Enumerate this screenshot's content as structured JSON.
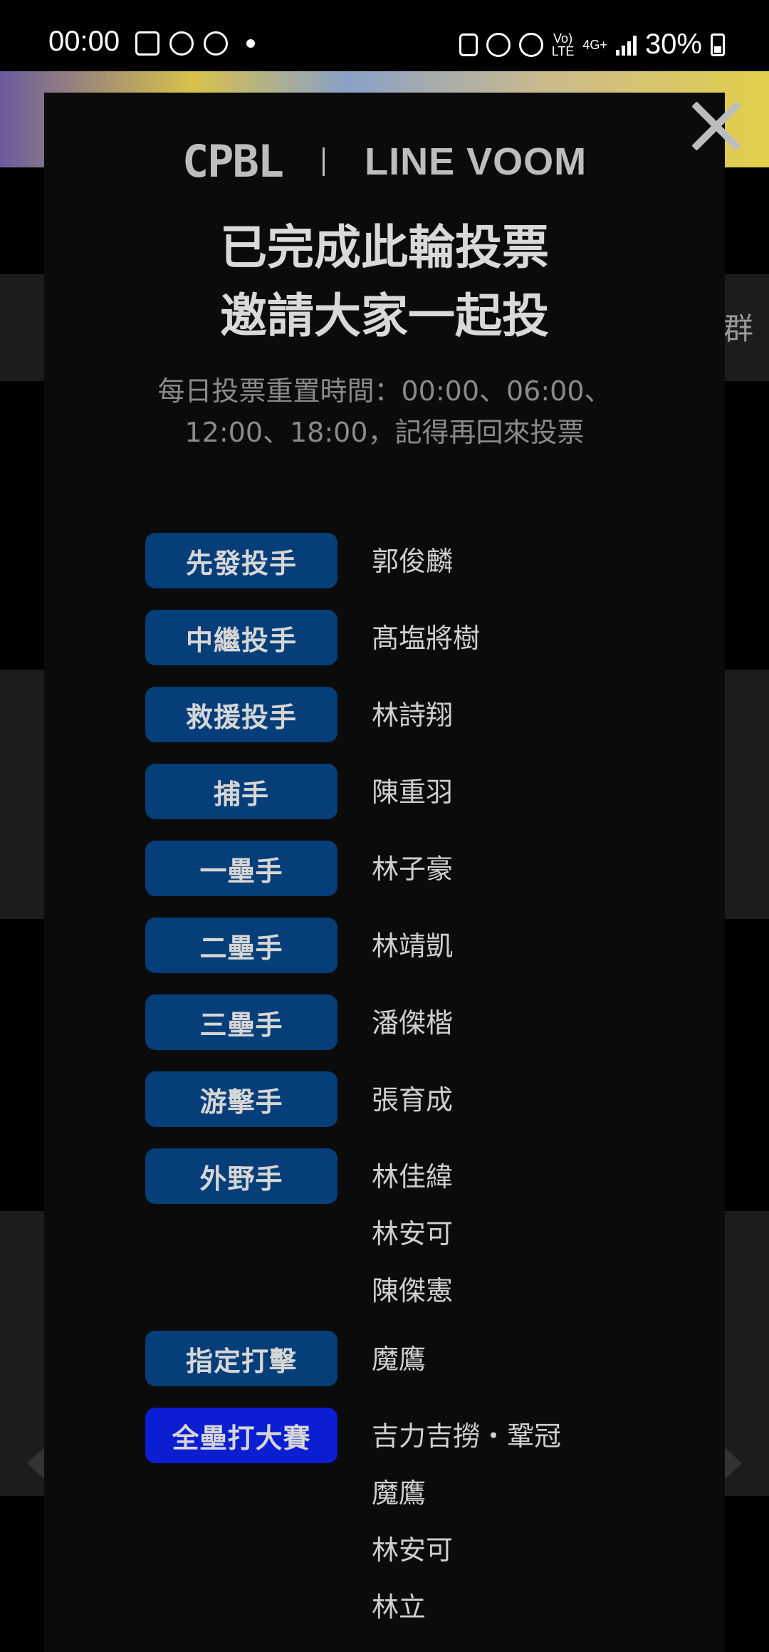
{
  "status_bar": {
    "time": "00:00",
    "network_volte": "Vo)\nLTE",
    "network_4g": "4G+",
    "battery_percent": "30%"
  },
  "background": {
    "edge_text": "群"
  },
  "modal": {
    "logo_left": "CPBL",
    "logo_right": "LINE VOOM",
    "headline_line1": "已完成此輪投票",
    "headline_line2": "邀請大家一起投",
    "reset_note": "每日投票重置時間：00:00、06:00、12:00、18:00，記得再回來投票",
    "votes": [
      {
        "position": "先發投手",
        "names": [
          "郭俊麟"
        ]
      },
      {
        "position": "中繼投手",
        "names": [
          "髙塩將樹"
        ]
      },
      {
        "position": "救援投手",
        "names": [
          "林詩翔"
        ]
      },
      {
        "position": "捕手",
        "names": [
          "陳重羽"
        ]
      },
      {
        "position": "一壘手",
        "names": [
          "林子豪"
        ]
      },
      {
        "position": "二壘手",
        "names": [
          "林靖凱"
        ]
      },
      {
        "position": "三壘手",
        "names": [
          "潘傑楷"
        ]
      },
      {
        "position": "游擊手",
        "names": [
          "張育成"
        ]
      },
      {
        "position": "外野手",
        "names": [
          "林佳緯",
          "林安可",
          "陳傑憲"
        ]
      },
      {
        "position": "指定打擊",
        "names": [
          "魔鷹"
        ]
      },
      {
        "position": "全壘打大賽",
        "names": [
          "吉力吉撈・鞏冠",
          "魔鷹",
          "林安可",
          "林立"
        ]
      }
    ],
    "colors": {
      "position_badge": "#053e78",
      "allstar_badge": "#0b1ed2",
      "modal_bg": "#0b0b0b"
    }
  }
}
